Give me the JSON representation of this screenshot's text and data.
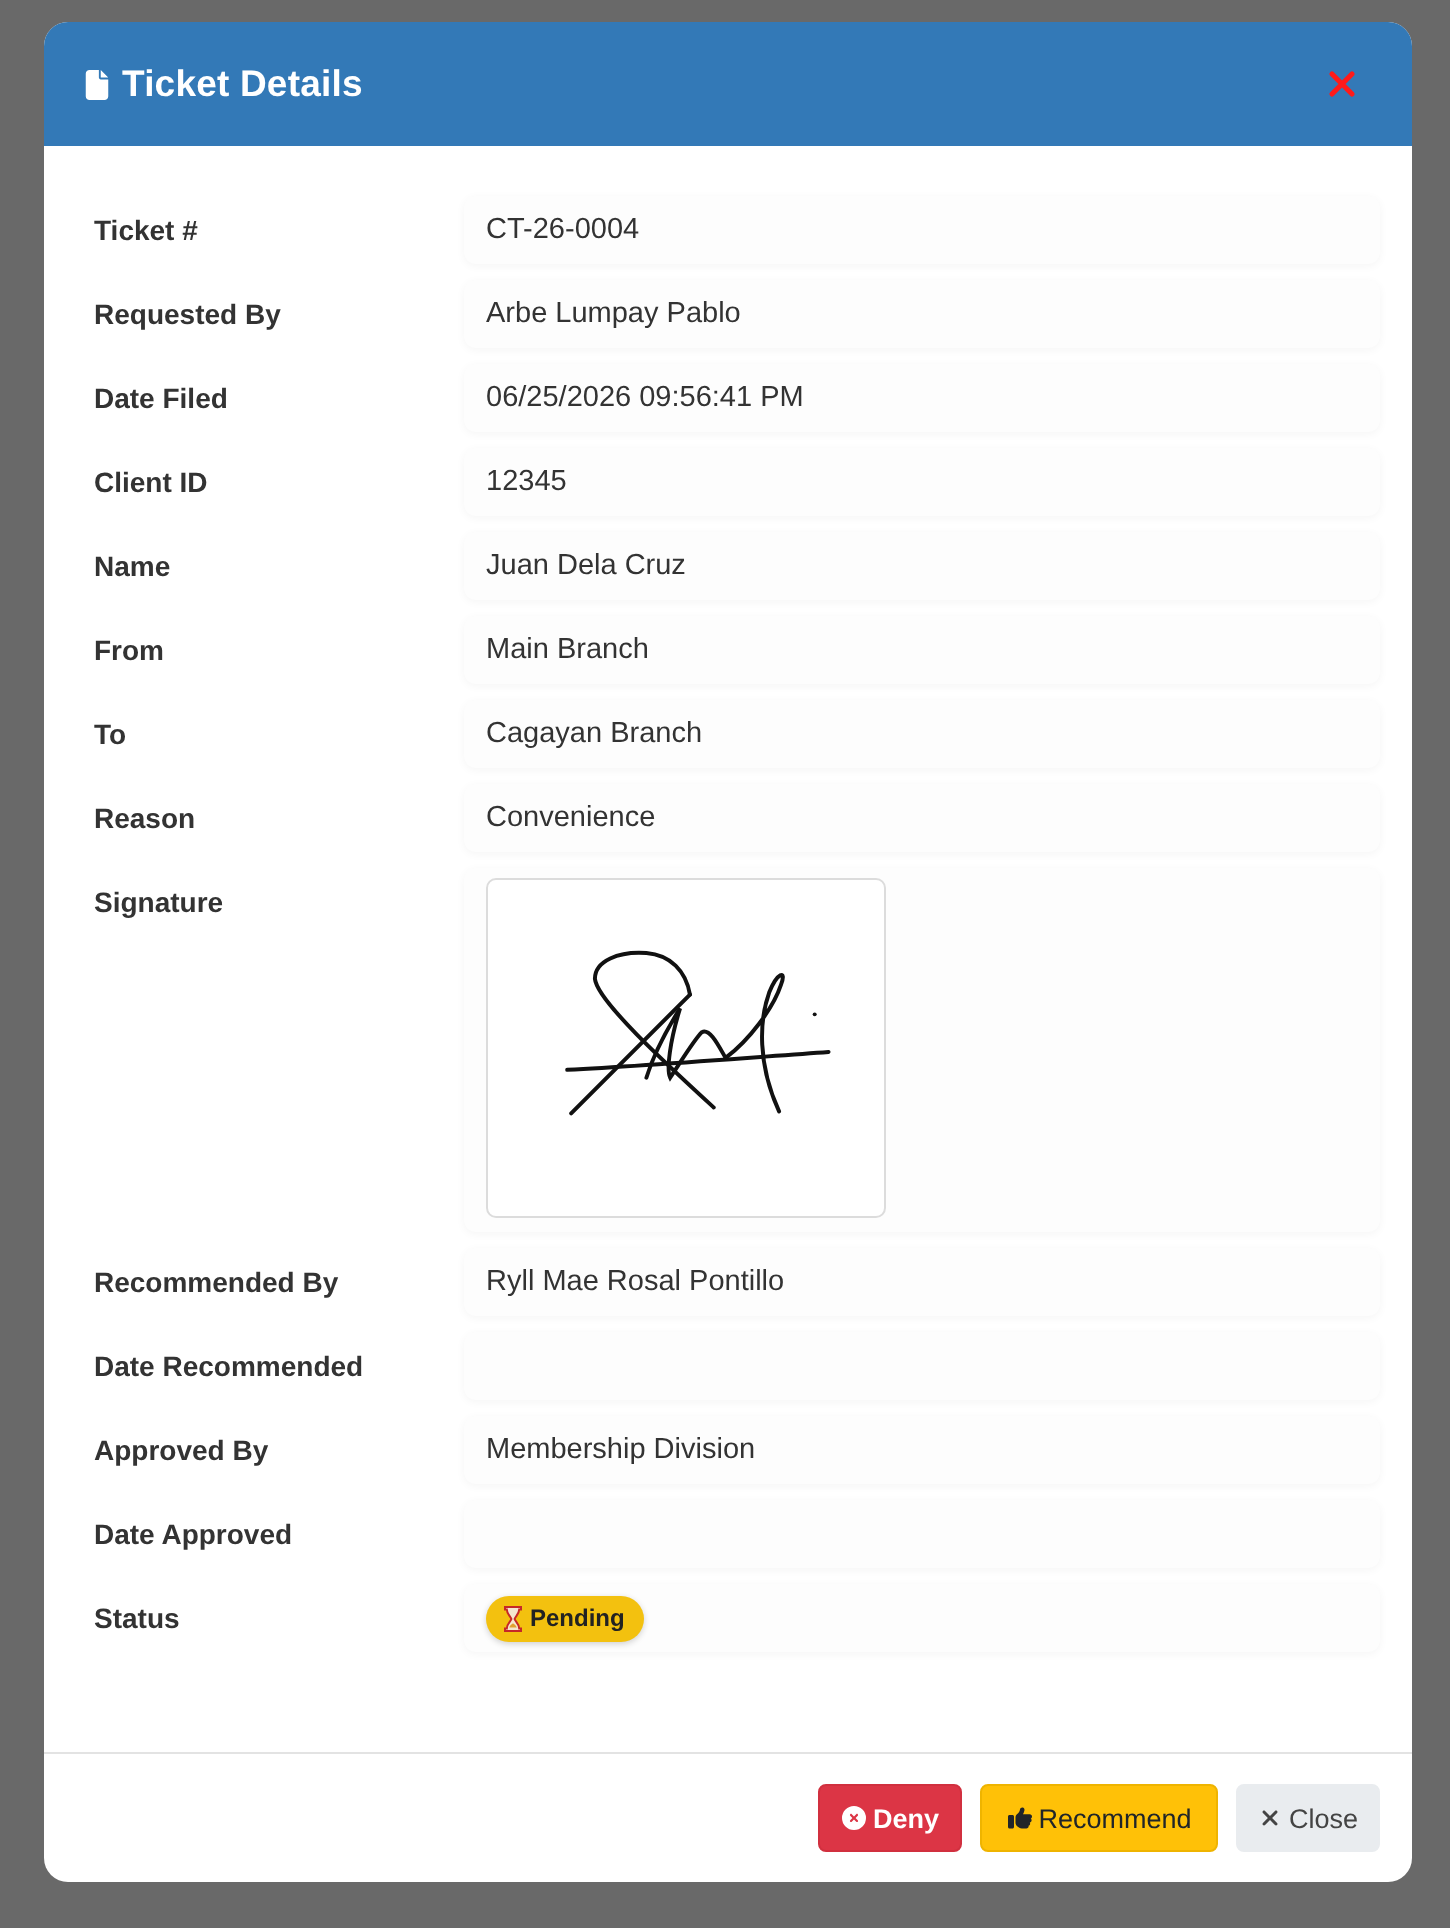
{
  "modal": {
    "title": "Ticket Details"
  },
  "fields": [
    {
      "label": "Ticket #",
      "kind": "text",
      "value": "CT-26-0004"
    },
    {
      "label": "Requested By",
      "kind": "text",
      "value": "Arbe Lumpay Pablo"
    },
    {
      "label": "Date Filed",
      "kind": "text",
      "value": "06/25/2026 09:56:41 PM"
    },
    {
      "label": "Client ID",
      "kind": "text",
      "value": "12345"
    },
    {
      "label": "Name",
      "kind": "text",
      "value": "Juan Dela Cruz"
    },
    {
      "label": "From",
      "kind": "text",
      "value": "Main Branch"
    },
    {
      "label": "To",
      "kind": "text",
      "value": "Cagayan Branch"
    },
    {
      "label": "Reason",
      "kind": "text",
      "value": "Convenience"
    },
    {
      "label": "Signature",
      "kind": "signature"
    },
    {
      "label": "Recommended By",
      "kind": "text",
      "value": "Ryll Mae Rosal Pontillo"
    },
    {
      "label": "Date Recommended",
      "kind": "text"
    },
    {
      "label": "Approved By",
      "kind": "text",
      "value": "Membership Division"
    },
    {
      "label": "Date Approved",
      "kind": "text"
    },
    {
      "label": "Status",
      "kind": "status",
      "value": "Pending"
    }
  ],
  "buttons": [
    {
      "label": "Deny",
      "kind": "danger"
    },
    {
      "label": "Recommend",
      "kind": "warning"
    },
    {
      "label": "Close",
      "kind": "light"
    }
  ]
}
